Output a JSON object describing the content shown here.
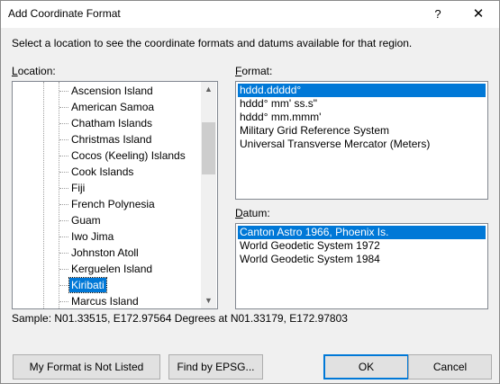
{
  "window": {
    "title": "Add Coordinate Format",
    "help_label": "?",
    "close_label": "✕"
  },
  "instruction": "Select a location to see the coordinate formats and datums available for that region.",
  "location": {
    "label_access": "L",
    "label_rest": "ocation:",
    "items": [
      {
        "label": "Ascension Island",
        "selected": false
      },
      {
        "label": "American Samoa",
        "selected": false
      },
      {
        "label": "Chatham Islands",
        "selected": false
      },
      {
        "label": "Christmas Island",
        "selected": false
      },
      {
        "label": "Cocos (Keeling) Islands",
        "selected": false
      },
      {
        "label": "Cook Islands",
        "selected": false
      },
      {
        "label": "Fiji",
        "selected": false
      },
      {
        "label": "French Polynesia",
        "selected": false
      },
      {
        "label": "Guam",
        "selected": false
      },
      {
        "label": "Iwo Jima",
        "selected": false
      },
      {
        "label": "Johnston Atoll",
        "selected": false
      },
      {
        "label": "Kerguelen Island",
        "selected": false
      },
      {
        "label": "Kiribati",
        "selected": true
      },
      {
        "label": "Marcus Island",
        "selected": false
      }
    ],
    "scroll_up": "▲",
    "scroll_down": "▼"
  },
  "format": {
    "label_access": "F",
    "label_rest": "ormat:",
    "items": [
      {
        "label": "hddd.ddddd°",
        "selected": true
      },
      {
        "label": "hddd° mm' ss.s\"",
        "selected": false
      },
      {
        "label": "hddd° mm.mmm'",
        "selected": false
      },
      {
        "label": "Military Grid Reference System",
        "selected": false
      },
      {
        "label": "Universal Transverse Mercator (Meters)",
        "selected": false
      }
    ]
  },
  "datum": {
    "label_access": "D",
    "label_rest": "atum:",
    "items": [
      {
        "label": "Canton Astro 1966, Phoenix Is.",
        "selected": true
      },
      {
        "label": "World Geodetic System 1972",
        "selected": false
      },
      {
        "label": "World Geodetic System 1984",
        "selected": false
      }
    ]
  },
  "sample": "Sample: N01.33515, E172.97564 Degrees at N01.33179, E172.97803",
  "buttons": {
    "not_listed": "My Format is Not Listed",
    "find_epsg": "Find by EPSG...",
    "ok": "OK",
    "cancel": "Cancel"
  },
  "colors": {
    "selection": "#0078d7",
    "dialog_bg": "#f0f0f0"
  }
}
